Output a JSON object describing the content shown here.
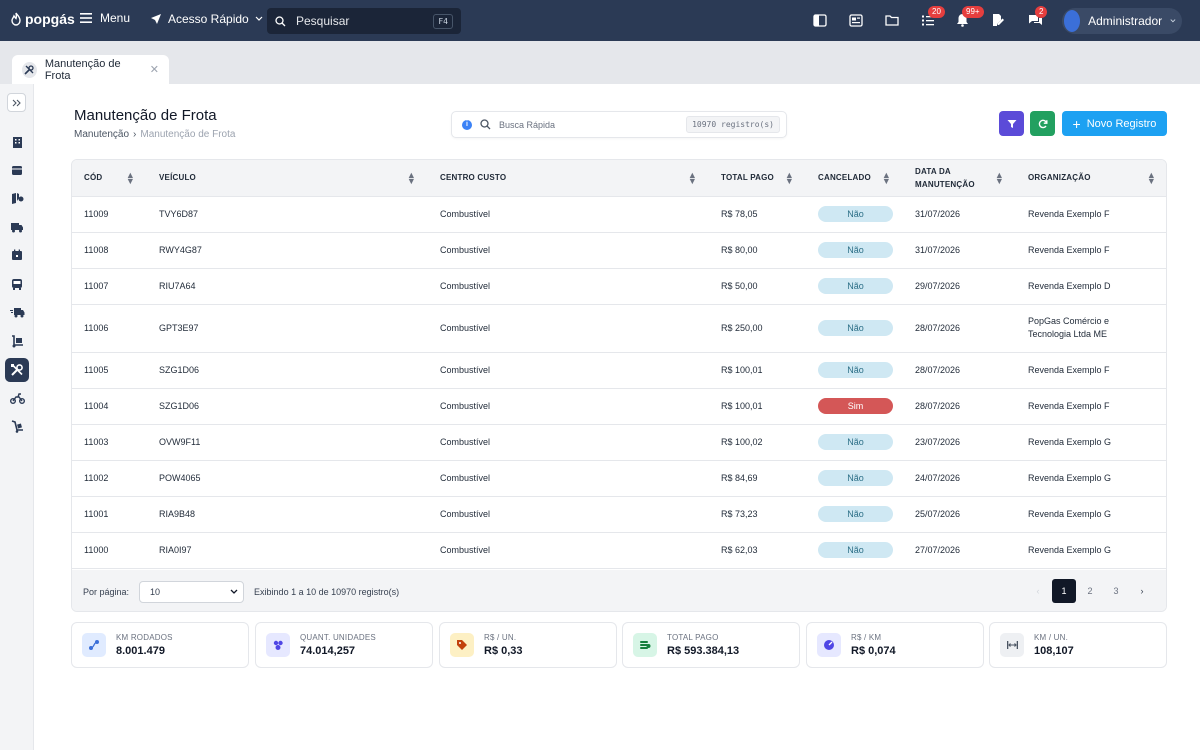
{
  "topbar": {
    "logo": "popgás",
    "menu_label": "Menu",
    "quick_access_label": "Acesso Rápido",
    "search_placeholder": "Pesquisar",
    "search_shortcut": "F4",
    "badges": {
      "tasks": "20",
      "notifications": "99+",
      "chat": "2"
    },
    "user_name": "Administrador"
  },
  "tab": {
    "label": "Manutenção de Frota"
  },
  "page": {
    "title": "Manutenção de Frota",
    "breadcrumb": [
      "Manutenção",
      "Manutenção de Frota"
    ],
    "breadcrumb_sep": "›",
    "quick_search_placeholder": "Busca Rápida",
    "record_count": "10970 registro(s)",
    "new_button": "Novo Registro"
  },
  "table": {
    "columns": [
      "Cód",
      "Veículo",
      "Centro Custo",
      "Total Pago",
      "Cancelado",
      "Data da Manutenção",
      "Organização"
    ],
    "rows": [
      {
        "cod": "11009",
        "veiculo": "TVY6D87",
        "centro": "Combustível",
        "total": "R$ 78,05",
        "cancelado": "Não",
        "data": "31/07/2026",
        "org": "Revenda Exemplo F"
      },
      {
        "cod": "11008",
        "veiculo": "RWY4G87",
        "centro": "Combustível",
        "total": "R$ 80,00",
        "cancelado": "Não",
        "data": "31/07/2026",
        "org": "Revenda Exemplo F"
      },
      {
        "cod": "11007",
        "veiculo": "RIU7A64",
        "centro": "Combustível",
        "total": "R$ 50,00",
        "cancelado": "Não",
        "data": "29/07/2026",
        "org": "Revenda Exemplo D"
      },
      {
        "cod": "11006",
        "veiculo": "GPT3E97",
        "centro": "Combustível",
        "total": "R$ 250,00",
        "cancelado": "Não",
        "data": "28/07/2026",
        "org": "PopGas Comércio e Tecnologia Ltda ME"
      },
      {
        "cod": "11005",
        "veiculo": "SZG1D06",
        "centro": "Combustível",
        "total": "R$ 100,01",
        "cancelado": "Não",
        "data": "28/07/2026",
        "org": "Revenda Exemplo F"
      },
      {
        "cod": "11004",
        "veiculo": "SZG1D06",
        "centro": "Combustível",
        "total": "R$ 100,01",
        "cancelado": "Sim",
        "data": "28/07/2026",
        "org": "Revenda Exemplo F"
      },
      {
        "cod": "11003",
        "veiculo": "OVW9F11",
        "centro": "Combustível",
        "total": "R$ 100,02",
        "cancelado": "Não",
        "data": "23/07/2026",
        "org": "Revenda Exemplo G"
      },
      {
        "cod": "11002",
        "veiculo": "POW4065",
        "centro": "Combustível",
        "total": "R$ 84,69",
        "cancelado": "Não",
        "data": "24/07/2026",
        "org": "Revenda Exemplo G"
      },
      {
        "cod": "11001",
        "veiculo": "RIA9B48",
        "centro": "Combustível",
        "total": "R$ 73,23",
        "cancelado": "Não",
        "data": "25/07/2026",
        "org": "Revenda Exemplo G"
      },
      {
        "cod": "11000",
        "veiculo": "RIA0I97",
        "centro": "Combustível",
        "total": "R$ 62,03",
        "cancelado": "Não",
        "data": "27/07/2026",
        "org": "Revenda Exemplo G"
      }
    ]
  },
  "pagination": {
    "per_page_label": "Por página:",
    "per_page_value": "10",
    "summary": "Exibindo 1 a 10 de 10970 registro(s)",
    "pages": [
      "1",
      "2",
      "3"
    ],
    "current_page": "1"
  },
  "kpis": [
    {
      "label": "KM Rodados",
      "value": "8.001.479",
      "icon": "route-icon",
      "color": "#e0ebff"
    },
    {
      "label": "Quant. Unidades",
      "value": "74.014,257",
      "icon": "units-icon",
      "color": "#e6e8ff"
    },
    {
      "label": "R$ / Un.",
      "value": "R$ 0,33",
      "icon": "tag-icon",
      "color": "#fdf0c4"
    },
    {
      "label": "Total Pago",
      "value": "R$ 593.384,13",
      "icon": "money-icon",
      "color": "#d7f5e6"
    },
    {
      "label": "R$ / KM",
      "value": "R$ 0,074",
      "icon": "gauge-icon",
      "color": "#e6e8ff"
    },
    {
      "label": "KM / Un.",
      "value": "108,107",
      "icon": "distance-icon",
      "color": "#eef0f3"
    }
  ],
  "colors": {
    "topbar": "#2b3a55",
    "primary": "#1da1f2",
    "filter": "#5b4bd8",
    "refresh": "#22a060",
    "cancel_yes": "#d45757",
    "cancel_no": "#cfe8f3"
  }
}
